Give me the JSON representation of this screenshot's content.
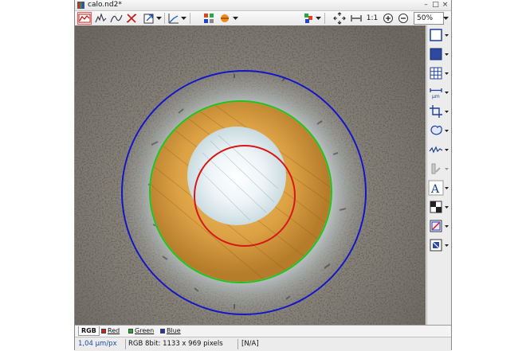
{
  "window": {
    "title": "calo.nd2*",
    "minimize_glyph": "–",
    "maximize_glyph": "□",
    "close_glyph": "×"
  },
  "toolbar": {
    "ratio_label": "1:1",
    "zoom_value": "50%"
  },
  "channel_tabs": [
    {
      "label": "RGB",
      "color": "",
      "active": true
    },
    {
      "label": "Red",
      "color": "#cc2222",
      "active": false
    },
    {
      "label": "Green",
      "color": "#22aa22",
      "active": false
    },
    {
      "label": "Blue",
      "color": "#2233bb",
      "active": false
    }
  ],
  "status": {
    "calibration": "1,04 µm/px",
    "image_info": "RGB 8bit: 1133 x 969 pixels",
    "value": "[N/A]"
  },
  "overlay_colors": {
    "outer_circle": "#1515c8",
    "middle_circle": "#22c41c",
    "inner_circle": "#d81616"
  },
  "sidebar_icons": [
    "rectangle-icon",
    "filled-rectangle-icon",
    "grid-icon",
    "measure-length-icon",
    "crop-icon",
    "shape-icon",
    "profile-icon",
    "edit-icon",
    "text-annotation-icon",
    "layers-icon",
    "overlay-icon",
    "binary-icon"
  ]
}
